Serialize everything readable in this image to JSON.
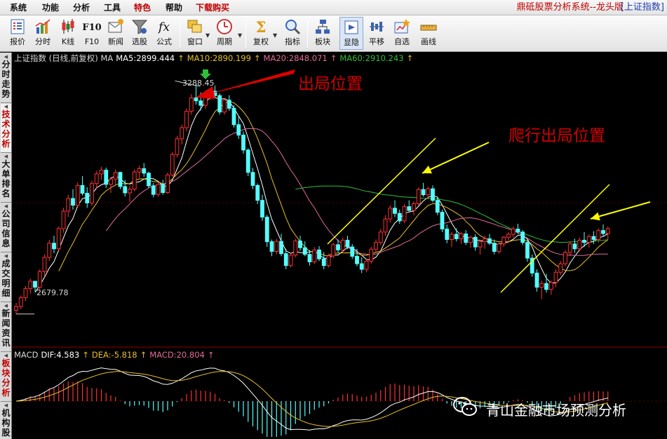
{
  "menu": {
    "items": [
      "系统",
      "功能",
      "分析",
      "工具",
      "特色",
      "帮助",
      "下载购买"
    ],
    "highlight_colors": {
      "特色": "#c00000",
      "下载购买": "#c00000"
    },
    "system_title": "鼎砥股票分析系统--龙头版",
    "system_index": "[上证指数]"
  },
  "toolbar": {
    "buttons": [
      {
        "label": "报价",
        "icon": "quote-list-icon"
      },
      {
        "label": "分时",
        "icon": "intraday-chart-icon"
      },
      {
        "label": "K线",
        "icon": "candlestick-icon"
      },
      {
        "label": "F10",
        "icon": "f10-icon"
      },
      {
        "label": "新闻",
        "icon": "news-icon"
      },
      {
        "label": "选股",
        "icon": "stock-filter-icon"
      },
      {
        "label": "公式",
        "icon": "formula-icon"
      },
      {
        "label": "窗口",
        "icon": "window-icon"
      },
      {
        "label": "周期",
        "icon": "period-clock-icon"
      },
      {
        "label": "复权",
        "icon": "sigma-icon"
      },
      {
        "label": "指标",
        "icon": "indicator-magnifier-icon"
      },
      {
        "label": "板块",
        "icon": "sector-icon"
      },
      {
        "label": "显隐",
        "icon": "show-hide-icon"
      },
      {
        "label": "平移",
        "icon": "pan-icon"
      },
      {
        "label": "自选",
        "icon": "watchlist-icon"
      },
      {
        "label": "画线",
        "icon": "draw-line-icon"
      }
    ]
  },
  "side_tabs": [
    {
      "label": "分时走势",
      "active": false
    },
    {
      "label": "技术分析",
      "active": true
    },
    {
      "label": "大单排名",
      "active": false
    },
    {
      "label": "公司信息",
      "active": false
    },
    {
      "label": "成交明细",
      "active": false
    },
    {
      "label": "新闻资讯",
      "active": false
    },
    {
      "label": "板块分析",
      "active": false
    },
    {
      "label": "机构股",
      "active": false
    }
  ],
  "main_legend": {
    "title": "上证指数 (日线,前复权) MA",
    "items": [
      {
        "label": "MA5:2899.444",
        "color": "#ffffff"
      },
      {
        "label": "MA10:2890.199",
        "color": "#e8c020"
      },
      {
        "label": "MA20:2848.071",
        "color": "#e36a9a"
      },
      {
        "label": "MA60:2910.243",
        "color": "#2fbf3a"
      }
    ]
  },
  "macd_legend": {
    "title": "MACD",
    "items": [
      {
        "label": "DIF:4.583",
        "color": "#ffffff"
      },
      {
        "label": "DEA:-5.818",
        "color": "#e8c020"
      },
      {
        "label": "MACD:20.804",
        "color": "#e36a9a"
      }
    ]
  },
  "price_labels": {
    "high": "3288.45",
    "low": "2679.78"
  },
  "annotations": {
    "exit_label": "出局位置",
    "crawl_exit_label": "爬行出局位置"
  },
  "watermark": {
    "text": "青山金融市场预测分析",
    "icon": "wechat-icon"
  },
  "chart_data": {
    "type": "candlestick",
    "symbol": "上证指数",
    "period": "日线,前复权",
    "candles": [
      [
        2680,
        2700,
        2670,
        2690
      ],
      [
        2690,
        2720,
        2683,
        2714
      ],
      [
        2714,
        2745,
        2705,
        2738
      ],
      [
        2738,
        2765,
        2724,
        2758
      ],
      [
        2758,
        2755,
        2730,
        2742
      ],
      [
        2742,
        2790,
        2735,
        2784
      ],
      [
        2784,
        2830,
        2772,
        2822
      ],
      [
        2822,
        2869,
        2812,
        2860
      ],
      [
        2860,
        2880,
        2833,
        2845
      ],
      [
        2845,
        2905,
        2840,
        2899
      ],
      [
        2899,
        2955,
        2888,
        2946
      ],
      [
        2946,
        2990,
        2930,
        2980
      ],
      [
        2980,
        3005,
        2950,
        2962
      ],
      [
        2962,
        3023,
        2955,
        3015
      ],
      [
        3015,
        3040,
        2988,
        2994
      ],
      [
        2994,
        3010,
        2955,
        2968
      ],
      [
        2968,
        3028,
        2960,
        3020
      ],
      [
        3020,
        3054,
        3005,
        3046
      ],
      [
        3046,
        3065,
        3030,
        3056
      ],
      [
        3056,
        3063,
        3008,
        3018
      ],
      [
        3018,
        3038,
        2995,
        3032
      ],
      [
        3032,
        3058,
        3018,
        3050
      ],
      [
        3050,
        3052,
        3005,
        3012
      ],
      [
        3012,
        3030,
        2985,
        2995
      ],
      [
        2995,
        3015,
        2970,
        3005
      ],
      [
        3005,
        3058,
        2999,
        3051
      ],
      [
        3051,
        3068,
        3035,
        3060
      ],
      [
        3060,
        3075,
        3038,
        3048
      ],
      [
        3048,
        3052,
        3008,
        3014
      ],
      [
        3014,
        3022,
        2983,
        2991
      ],
      [
        2991,
        3024,
        2985,
        3018
      ],
      [
        3018,
        3030,
        2990,
        2996
      ],
      [
        2996,
        3050,
        2992,
        3043
      ],
      [
        3043,
        3105,
        3038,
        3098
      ],
      [
        3098,
        3148,
        3090,
        3140
      ],
      [
        3140,
        3178,
        3125,
        3170
      ],
      [
        3170,
        3222,
        3160,
        3214
      ],
      [
        3214,
        3260,
        3205,
        3250
      ],
      [
        3250,
        3288,
        3232,
        3242
      ],
      [
        3242,
        3265,
        3216,
        3230
      ],
      [
        3230,
        3270,
        3220,
        3262
      ],
      [
        3262,
        3275,
        3244,
        3268
      ],
      [
        3268,
        3283,
        3250,
        3256
      ],
      [
        3256,
        3262,
        3205,
        3212
      ],
      [
        3212,
        3250,
        3205,
        3244
      ],
      [
        3244,
        3257,
        3215,
        3222
      ],
      [
        3222,
        3230,
        3170,
        3178
      ],
      [
        3178,
        3200,
        3140,
        3150
      ],
      [
        3150,
        3160,
        3100,
        3110
      ],
      [
        3110,
        3115,
        3040,
        3050
      ],
      [
        3050,
        3062,
        3005,
        3015
      ],
      [
        3015,
        3020,
        2965,
        2975
      ],
      [
        2975,
        2990,
        2920,
        2930
      ],
      [
        2930,
        2936,
        2850,
        2864
      ],
      [
        2864,
        2870,
        2825,
        2838
      ],
      [
        2838,
        2872,
        2830,
        2865
      ],
      [
        2865,
        2885,
        2825,
        2832
      ],
      [
        2832,
        2845,
        2790,
        2800
      ],
      [
        2800,
        2835,
        2795,
        2828
      ],
      [
        2828,
        2872,
        2822,
        2866
      ],
      [
        2866,
        2880,
        2840,
        2848
      ],
      [
        2848,
        2865,
        2825,
        2830
      ],
      [
        2830,
        2842,
        2800,
        2810
      ],
      [
        2810,
        2850,
        2804,
        2842
      ],
      [
        2842,
        2852,
        2812,
        2818
      ],
      [
        2818,
        2836,
        2790,
        2800
      ],
      [
        2800,
        2832,
        2795,
        2826
      ],
      [
        2826,
        2862,
        2820,
        2856
      ],
      [
        2856,
        2870,
        2835,
        2842
      ],
      [
        2842,
        2875,
        2836,
        2868
      ],
      [
        2868,
        2880,
        2844,
        2850
      ],
      [
        2850,
        2858,
        2818,
        2825
      ],
      [
        2825,
        2845,
        2798,
        2805
      ],
      [
        2805,
        2822,
        2780,
        2790
      ],
      [
        2790,
        2818,
        2782,
        2812
      ],
      [
        2812,
        2850,
        2805,
        2844
      ],
      [
        2844,
        2870,
        2836,
        2862
      ],
      [
        2862,
        2898,
        2855,
        2890
      ],
      [
        2890,
        2935,
        2880,
        2925
      ],
      [
        2925,
        2962,
        2915,
        2954
      ],
      [
        2954,
        2975,
        2930,
        2940
      ],
      [
        2940,
        2950,
        2912,
        2920
      ],
      [
        2920,
        2965,
        2914,
        2958
      ],
      [
        2958,
        2975,
        2945,
        2948
      ],
      [
        2948,
        2972,
        2935,
        2966
      ],
      [
        2966,
        3010,
        2960,
        3004
      ],
      [
        3004,
        3022,
        2985,
        2990
      ],
      [
        2990,
        3012,
        2978,
        3006
      ],
      [
        3006,
        3015,
        2970,
        2975
      ],
      [
        2975,
        2985,
        2935,
        2943
      ],
      [
        2943,
        2950,
        2890,
        2898
      ],
      [
        2898,
        2910,
        2860,
        2870
      ],
      [
        2870,
        2890,
        2850,
        2884
      ],
      [
        2884,
        2900,
        2865,
        2872
      ],
      [
        2872,
        2890,
        2858,
        2885
      ],
      [
        2885,
        2895,
        2855,
        2862
      ],
      [
        2862,
        2880,
        2848,
        2876
      ],
      [
        2876,
        2884,
        2840,
        2850
      ],
      [
        2850,
        2870,
        2830,
        2864
      ],
      [
        2864,
        2880,
        2845,
        2872
      ],
      [
        2872,
        2885,
        2855,
        2860
      ],
      [
        2860,
        2870,
        2830,
        2838
      ],
      [
        2838,
        2862,
        2832,
        2858
      ],
      [
        2858,
        2880,
        2850,
        2876
      ],
      [
        2876,
        2890,
        2862,
        2884
      ],
      [
        2884,
        2905,
        2875,
        2898
      ],
      [
        2898,
        2912,
        2885,
        2890
      ],
      [
        2890,
        2895,
        2855,
        2862
      ],
      [
        2862,
        2868,
        2810,
        2820
      ],
      [
        2820,
        2830,
        2770,
        2780
      ],
      [
        2780,
        2790,
        2730,
        2742
      ],
      [
        2742,
        2760,
        2710,
        2752
      ],
      [
        2752,
        2778,
        2728,
        2736
      ],
      [
        2736,
        2760,
        2722,
        2755
      ],
      [
        2755,
        2790,
        2742,
        2782
      ],
      [
        2782,
        2812,
        2775,
        2805
      ],
      [
        2805,
        2842,
        2798,
        2835
      ],
      [
        2835,
        2865,
        2825,
        2858
      ],
      [
        2858,
        2872,
        2834,
        2845
      ],
      [
        2845,
        2875,
        2838,
        2868
      ],
      [
        2868,
        2890,
        2850,
        2862
      ],
      [
        2862,
        2884,
        2848,
        2878
      ],
      [
        2878,
        2892,
        2858,
        2870
      ],
      [
        2870,
        2900,
        2862,
        2894
      ],
      [
        2894,
        2910,
        2878,
        2886
      ],
      [
        2886,
        2905,
        2870,
        2899
      ]
    ],
    "ma_series": [
      {
        "name": "MA5",
        "color": "#ffffff",
        "last": 2899.444
      },
      {
        "name": "MA10",
        "color": "#e8c020",
        "last": 2890.199
      },
      {
        "name": "MA20",
        "color": "#e36a9a",
        "last": 2848.071
      },
      {
        "name": "MA60",
        "color": "#2fbf3a",
        "last": 2910.243
      }
    ],
    "macd": {
      "dif": 4.583,
      "dea": -5.818,
      "macd": 20.804
    },
    "marked_high": 3288.45,
    "marked_low": 2679.78,
    "colors": {
      "up": "#ff3232",
      "down": "#54ffff",
      "trendline": "#ffff00",
      "exit_arrow": "#e00000"
    }
  }
}
